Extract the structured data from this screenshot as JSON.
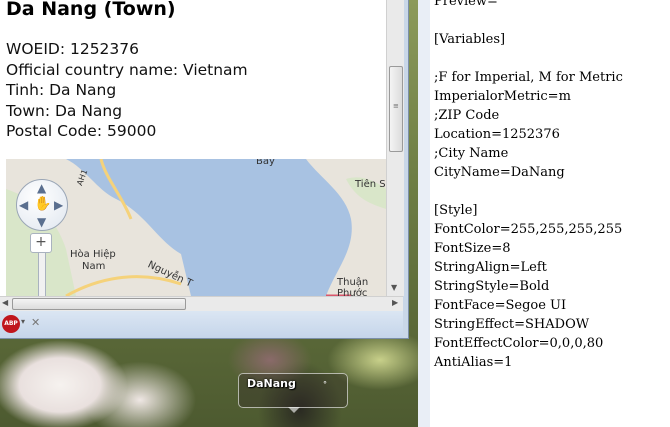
{
  "browser": {
    "page_title": "Da Nang (Town)",
    "info_lines": [
      "WOEID: 1252376",
      "Official country name: Vietnam",
      "Tinh: Da Nang",
      "Town: Da Nang",
      "Postal Code: 59000"
    ],
    "map_labels": {
      "bay": "Bay",
      "tien_sa": "Tiên Sa",
      "hoa_hiep": "Hòa Hiệp",
      "nam": "Nam",
      "road": "Nguyễn T",
      "thuan": "Thuận",
      "phuoc": "Phước",
      "ah1": "AH1"
    },
    "zoom_plus": "+",
    "abp_label": "ABP"
  },
  "editor": {
    "lines": [
      "Preview=",
      "",
      "[Variables]",
      "",
      ";F for Imperial, M for Metric",
      "ImperialorMetric=m",
      ";ZIP Code",
      "Location=1252376",
      ";City Name",
      "CityName=DaNang",
      "",
      "[Style]",
      "FontColor=255,255,255,255",
      "FontSize=8",
      "StringAlign=Left",
      "StringStyle=Bold",
      "FontFace=Segoe UI",
      "StringEffect=SHADOW",
      "FontEffectColor=0,0,0,80",
      "AntiAlias=1"
    ]
  },
  "gadget": {
    "city": "DaNang",
    "degree": "°"
  }
}
